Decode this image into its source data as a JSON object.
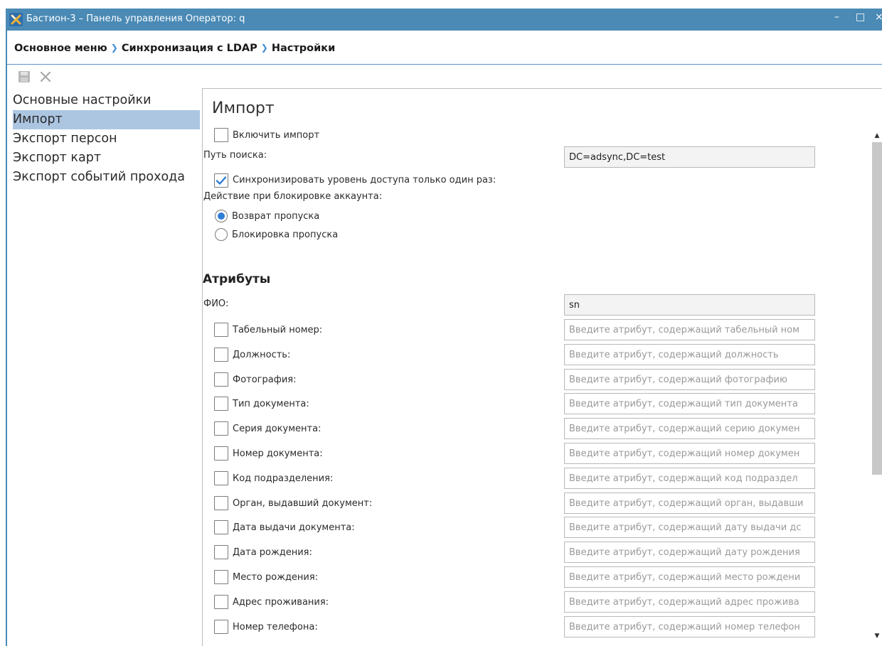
{
  "window": {
    "title": "Бастион-3 – Панель управления Оператор: q",
    "minimize": "–",
    "maximize": "□",
    "close": "×"
  },
  "breadcrumb": [
    "Основное меню",
    "Синхронизация с LDAP",
    "Настройки"
  ],
  "toolbar": {
    "save_icon": "save-icon",
    "close_icon": "close-icon"
  },
  "nav": {
    "items": [
      "Основные настройки",
      "Импорт",
      "Экспорт персон",
      "Экспорт карт",
      "Экспорт событий прохода"
    ],
    "active_index": 1
  },
  "import": {
    "title": "Импорт",
    "enable_label": "Включить импорт",
    "enable_checked": false,
    "search_path_label": "Путь поиска:",
    "search_path_value": "DC=adsync,DC=test",
    "sync_once_label": "Синхронизировать уровень доступа только один раз:",
    "sync_once_checked": true,
    "block_action_label": "Действие при блокировке аккаунта:",
    "radio_return_label": "Возврат пропуска",
    "radio_return_selected": true,
    "radio_block_label": "Блокировка пропуска",
    "radio_block_selected": false
  },
  "attributes": {
    "title": "Атрибуты",
    "fio_label": "ФИО:",
    "fio_value": "sn",
    "rows": [
      {
        "label": "Табельный номер:",
        "placeholder": "Введите атрибут, содержащий табельный ном"
      },
      {
        "label": "Должность:",
        "placeholder": "Введите атрибут, содержащий должность"
      },
      {
        "label": "Фотография:",
        "placeholder": "Введите атрибут, содержащий фотографию"
      },
      {
        "label": "Тип документа:",
        "placeholder": "Введите атрибут, содержащий тип документа"
      },
      {
        "label": "Серия документа:",
        "placeholder": "Введите атрибут, содержащий серию докумен"
      },
      {
        "label": "Номер документа:",
        "placeholder": "Введите атрибут, содержащий номер докумен"
      },
      {
        "label": "Код подразделения:",
        "placeholder": "Введите атрибут, содержащий код подраздел"
      },
      {
        "label": "Орган, выдавший документ:",
        "placeholder": "Введите атрибут, содержащий орган, выдавши"
      },
      {
        "label": "Дата выдачи документа:",
        "placeholder": "Введите атрибут, содержащий дату выдачи дс"
      },
      {
        "label": "Дата рождения:",
        "placeholder": "Введите атрибут, содержащий дату рождения"
      },
      {
        "label": "Место рождения:",
        "placeholder": "Введите атрибут, содержащий место рождени"
      },
      {
        "label": "Адрес проживания:",
        "placeholder": "Введите атрибут, содержащий адрес прожива"
      },
      {
        "label": "Номер телефона:",
        "placeholder": "Введите атрибут, содержащий номер телефон"
      }
    ]
  },
  "colors": {
    "titlebar": "#4a8ab5",
    "accent": "#3e8ed6",
    "nav_active": "#acc6e2"
  }
}
